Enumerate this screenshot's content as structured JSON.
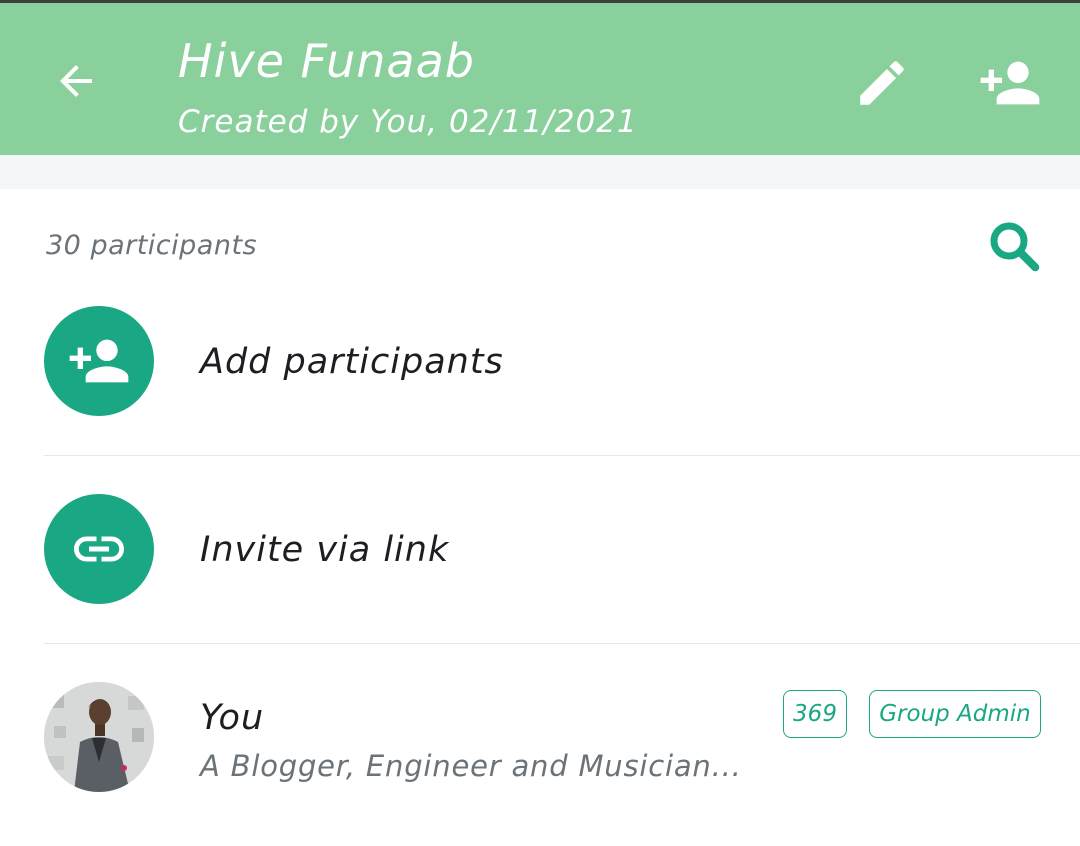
{
  "header": {
    "title": "Hive Funaab",
    "subtitle": "Created by You, 02/11/2021",
    "icons": {
      "back": "arrow-back-icon",
      "edit": "pencil-icon",
      "add_participant": "person-add-icon"
    }
  },
  "participants": {
    "count_label": "30 participants",
    "search_icon": "search-icon"
  },
  "actions": [
    {
      "label": "Add participants",
      "icon": "person-add-icon"
    },
    {
      "label": "Invite via link",
      "icon": "link-icon"
    }
  ],
  "members": [
    {
      "name": "You",
      "status": "A Blogger, Engineer and Musician...",
      "badge_count": "369",
      "role": "Group Admin"
    }
  ],
  "colors": {
    "header_bg": "#8ad09c",
    "accent": "#1aa784",
    "text_primary": "#1c1e21",
    "text_secondary": "#6b7378",
    "band_bg": "#f5f6f8"
  }
}
